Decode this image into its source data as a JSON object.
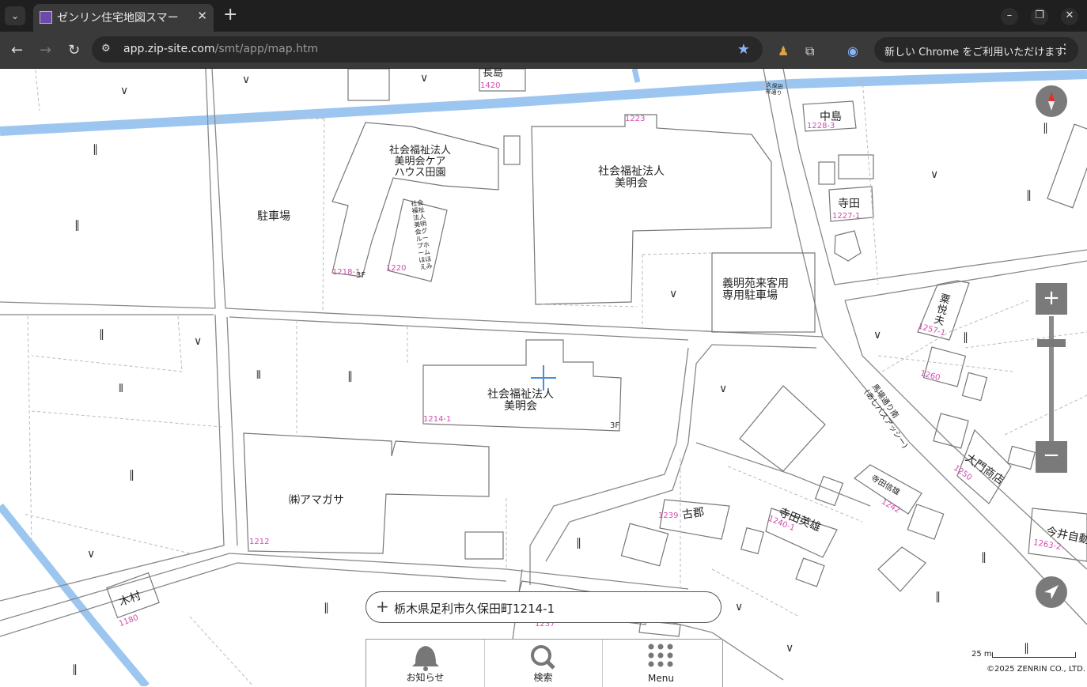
{
  "browser": {
    "tab_title": "ゼンリン住宅地図スマー",
    "url_host": "app.zip-site.com",
    "url_path": "/smt/app/map.htm",
    "update_text": "新しい Chrome をご利用いただけます"
  },
  "map": {
    "labels": {
      "nagashima": "長島",
      "nakajima": "中島",
      "terada": "寺田",
      "parking": "駐車場",
      "care_house": "社会福祉法人\n美明会ケア\nハウス田園",
      "group_home": "社会福祉法人美明会グループホームほほえみ",
      "shafuku_top": "社会福祉法人\n美明会",
      "visitor_parking": "義明苑来客用\n専用駐車場",
      "awata": "粟\n悦\n夫",
      "shafuku_center": "社会福祉法人\n美明会",
      "amagasa": "㈱アマガサ",
      "furugo": "古郡",
      "terada_hideo": "寺田英雄",
      "terada_nobuo": "寺田信雄",
      "daimon": "大門商店",
      "imai": "今井自動",
      "kimura": "木村",
      "road_kubota": "久保田\n排通り",
      "bus_stop": "馬場通り南\n(あしバスアッシー)"
    },
    "numbers": {
      "n1420": "1420",
      "n1223": "1223",
      "n1228_3": "1228-3",
      "n1227_1": "1227-1",
      "n1218_1": "1218-1",
      "n1220": "1220",
      "n1257_1": "1257-1",
      "n1260": "1260",
      "n1214_1": "1214-1",
      "n1250": "1250",
      "n1242": "1242",
      "n1239": "1239",
      "n1240_1": "1240-1",
      "n1212": "1212",
      "n1263_2": "1263-2",
      "n1180": "1180",
      "n1237": "1237",
      "floors_3f_a": "3F",
      "floors_3f_b": "3F"
    },
    "controls": {
      "zoom_in": "+",
      "zoom_out": "−",
      "scale": "25 m",
      "copyright": "©2025 ZENRIN CO., LTD."
    },
    "address": "栃木県足利市久保田町1214-1",
    "menu": [
      {
        "label": "お知らせ",
        "icon": "bell-icon"
      },
      {
        "label": "検索",
        "icon": "search-icon"
      },
      {
        "label": "Menu",
        "icon": "grid-icon"
      }
    ]
  }
}
